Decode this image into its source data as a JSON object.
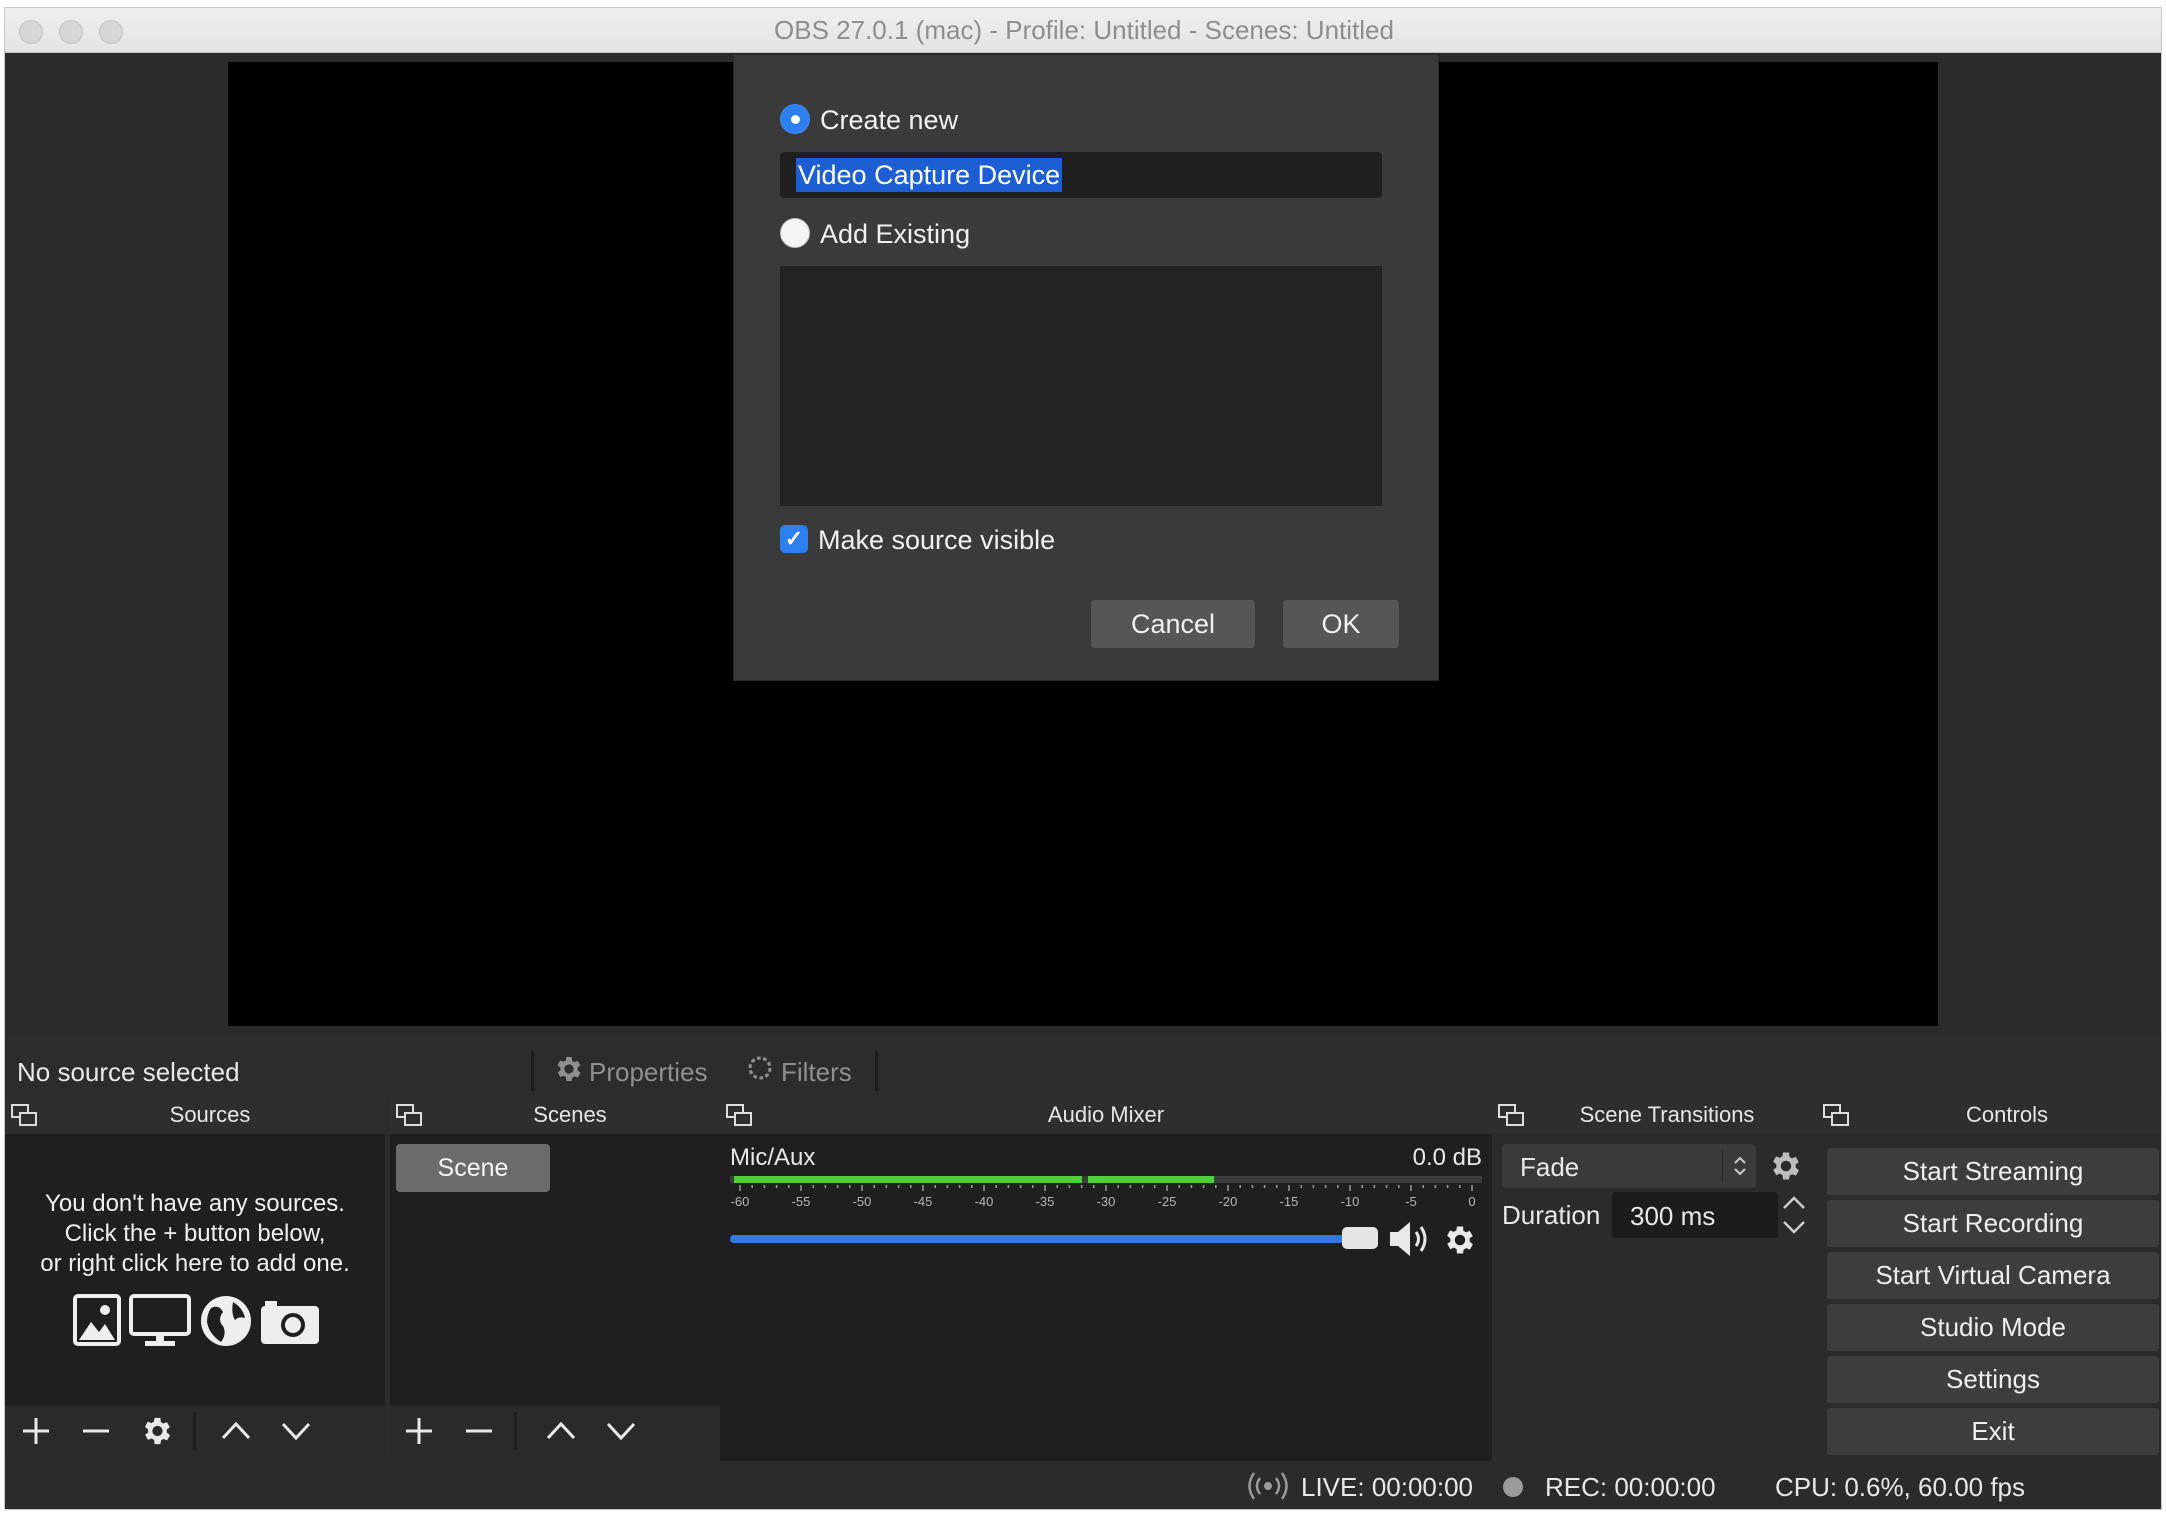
{
  "window": {
    "title": "OBS 27.0.1 (mac) - Profile: Untitled - Scenes: Untitled"
  },
  "dialog": {
    "create_new_label": "Create new",
    "create_new_selected": true,
    "name_value": "Video Capture Device",
    "add_existing_label": "Add Existing",
    "add_existing_selected": false,
    "make_visible_label": "Make source visible",
    "make_visible_checked": true,
    "cancel_label": "Cancel",
    "ok_label": "OK"
  },
  "source_bar": {
    "status": "No source selected",
    "properties_label": "Properties",
    "filters_label": "Filters"
  },
  "docks": {
    "sources": {
      "title": "Sources",
      "empty_message": [
        "You don't have any sources.",
        "Click the + button below,",
        "or right click here to add one."
      ],
      "icons": [
        "image-icon",
        "monitor-icon",
        "globe-icon",
        "camera-icon"
      ]
    },
    "scenes": {
      "title": "Scenes",
      "items": [
        "Scene"
      ]
    },
    "audio_mixer": {
      "title": "Audio Mixer",
      "channel_name": "Mic/Aux",
      "level": "0.0 dB",
      "scale": [
        "-60",
        "-55",
        "-50",
        "-45",
        "-40",
        "-35",
        "-30",
        "-25",
        "-20",
        "-15",
        "-10",
        "-5",
        "0"
      ],
      "volume_fraction": 1.0
    },
    "scene_transitions": {
      "title": "Scene Transitions",
      "transition": "Fade",
      "duration_label": "Duration",
      "duration_value": "300 ms"
    },
    "controls": {
      "title": "Controls",
      "buttons": [
        "Start Streaming",
        "Start Recording",
        "Start Virtual Camera",
        "Studio Mode",
        "Settings",
        "Exit"
      ]
    }
  },
  "status": {
    "live": "LIVE: 00:00:00",
    "rec": "REC: 00:00:00",
    "cpu": "CPU: 0.6%, 60.00 fps"
  },
  "colors": {
    "accent": "#2d7ff0",
    "meter_green": "#4cd137",
    "selection": "#1d5fd3"
  }
}
